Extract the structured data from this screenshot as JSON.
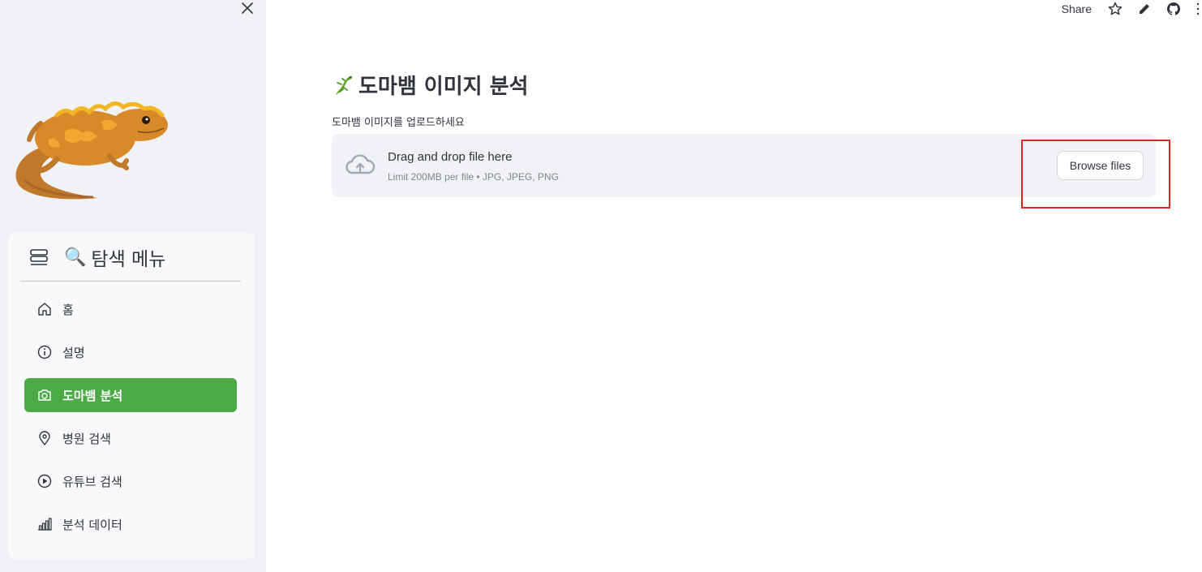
{
  "sidebar": {
    "close_icon": "close-icon",
    "menu_title": "탐색 메뉴",
    "menu_title_emoji": "🔍",
    "items": [
      {
        "label": "홈",
        "icon": "home-icon",
        "active": false
      },
      {
        "label": "설명",
        "icon": "info-icon",
        "active": false
      },
      {
        "label": "도마뱀 분석",
        "icon": "camera-icon",
        "active": true
      },
      {
        "label": "병원 검색",
        "icon": "location-pin-icon",
        "active": false
      },
      {
        "label": "유튜브 검색",
        "icon": "play-circle-icon",
        "active": false
      },
      {
        "label": "분석 데이터",
        "icon": "bar-chart-icon",
        "active": false
      }
    ],
    "active_color": "#4caa46"
  },
  "topbar": {
    "share_label": "Share"
  },
  "main": {
    "title": "도마뱀 이미지 분석",
    "upload_label": "도마뱀 이미지를 업로드하세요",
    "dropzone": {
      "primary": "Drag and drop file here",
      "secondary": "Limit 200MB per file • JPG, JPEG, PNG",
      "button": "Browse files"
    }
  },
  "colors": {
    "sidebar_bg": "#f0f2f6",
    "accent": "#4caa46",
    "highlight": "#e02424"
  }
}
